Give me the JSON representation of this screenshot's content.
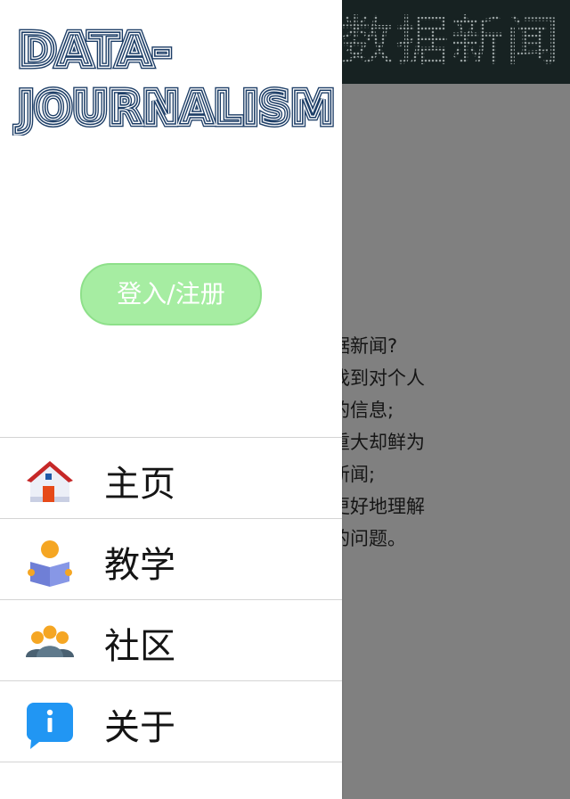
{
  "background": {
    "header_title": "数据新闻",
    "paragraph_lines": [
      "是数据新闻?",
      "卖者找到对个人",
      "意义的信息;",
      "一些重大却鲜为",
      "印的新闻;",
      "卖者更好地理解",
      "复杂的问题。"
    ]
  },
  "drawer": {
    "brand_line1": "DATA-",
    "brand_line2": "JOURNALISM",
    "login_button": "登入/注册",
    "menu": [
      {
        "label": "主页",
        "icon": "house-icon"
      },
      {
        "label": "教学",
        "icon": "reading-person-icon"
      },
      {
        "label": "社区",
        "icon": "people-group-icon"
      },
      {
        "label": "关于",
        "icon": "info-bubble-icon"
      }
    ]
  },
  "colors": {
    "brand_outline": "#1c3d66",
    "login_bg": "#a6eda2",
    "login_border": "#8ee08a",
    "header_bg": "#172222",
    "overlay": "#808080",
    "info_blue": "#2196f3",
    "icon_orange": "#f5a623"
  }
}
